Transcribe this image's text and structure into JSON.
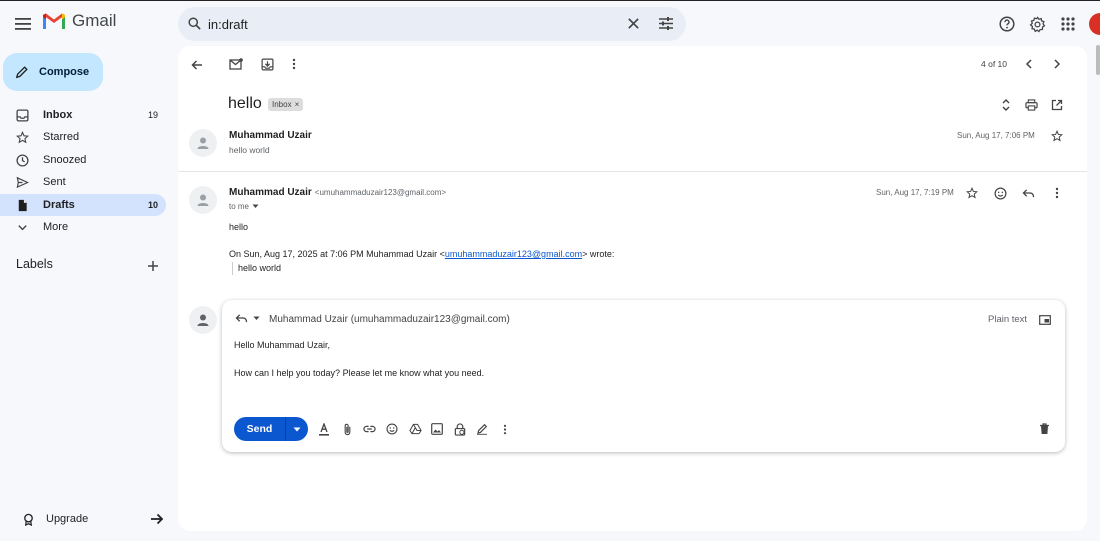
{
  "app": {
    "title": "Gmail"
  },
  "search": {
    "value": "in:draft"
  },
  "sidebar": {
    "compose_label": "Compose",
    "items": [
      {
        "label": "Inbox",
        "count": "19"
      },
      {
        "label": "Starred",
        "count": ""
      },
      {
        "label": "Snoozed",
        "count": ""
      },
      {
        "label": "Sent",
        "count": ""
      },
      {
        "label": "Drafts",
        "count": "10"
      },
      {
        "label": "More",
        "count": ""
      }
    ],
    "labels_heading": "Labels",
    "upgrade_label": "Upgrade"
  },
  "toolbar": {
    "pagination": "4 of 10"
  },
  "thread": {
    "subject": "hello",
    "label_badge": "Inbox",
    "messages": [
      {
        "sender": "Muhammad Uzair",
        "snippet": "hello world",
        "date": "Sun, Aug 17, 7:06 PM"
      },
      {
        "sender": "Muhammad Uzair",
        "email": "<umuhammaduzair123@gmail.com>",
        "to": "to me",
        "date": "Sun, Aug 17, 7:19 PM",
        "body": "hello",
        "quote_prefix": "On Sun, Aug 17, 2025 at 7:06 PM Muhammad Uzair <",
        "quote_link": "umuhammaduzair123@gmail.com",
        "quote_suffix": "> wrote:",
        "quoted_text": "hello world"
      }
    ]
  },
  "reply": {
    "recipient": "Muhammad Uzair (umuhammaduzair123@gmail.com)",
    "plain_text_label": "Plain text",
    "line1": "Hello Muhammad Uzair,",
    "line2": "How can I help you today?  Please let me know what you need.",
    "send_label": "Send"
  },
  "colors": {
    "accent": "#0b57d0",
    "compose_bg": "#c2e7ff",
    "active_nav": "#d3e3fd",
    "avatar": "#d93025"
  }
}
